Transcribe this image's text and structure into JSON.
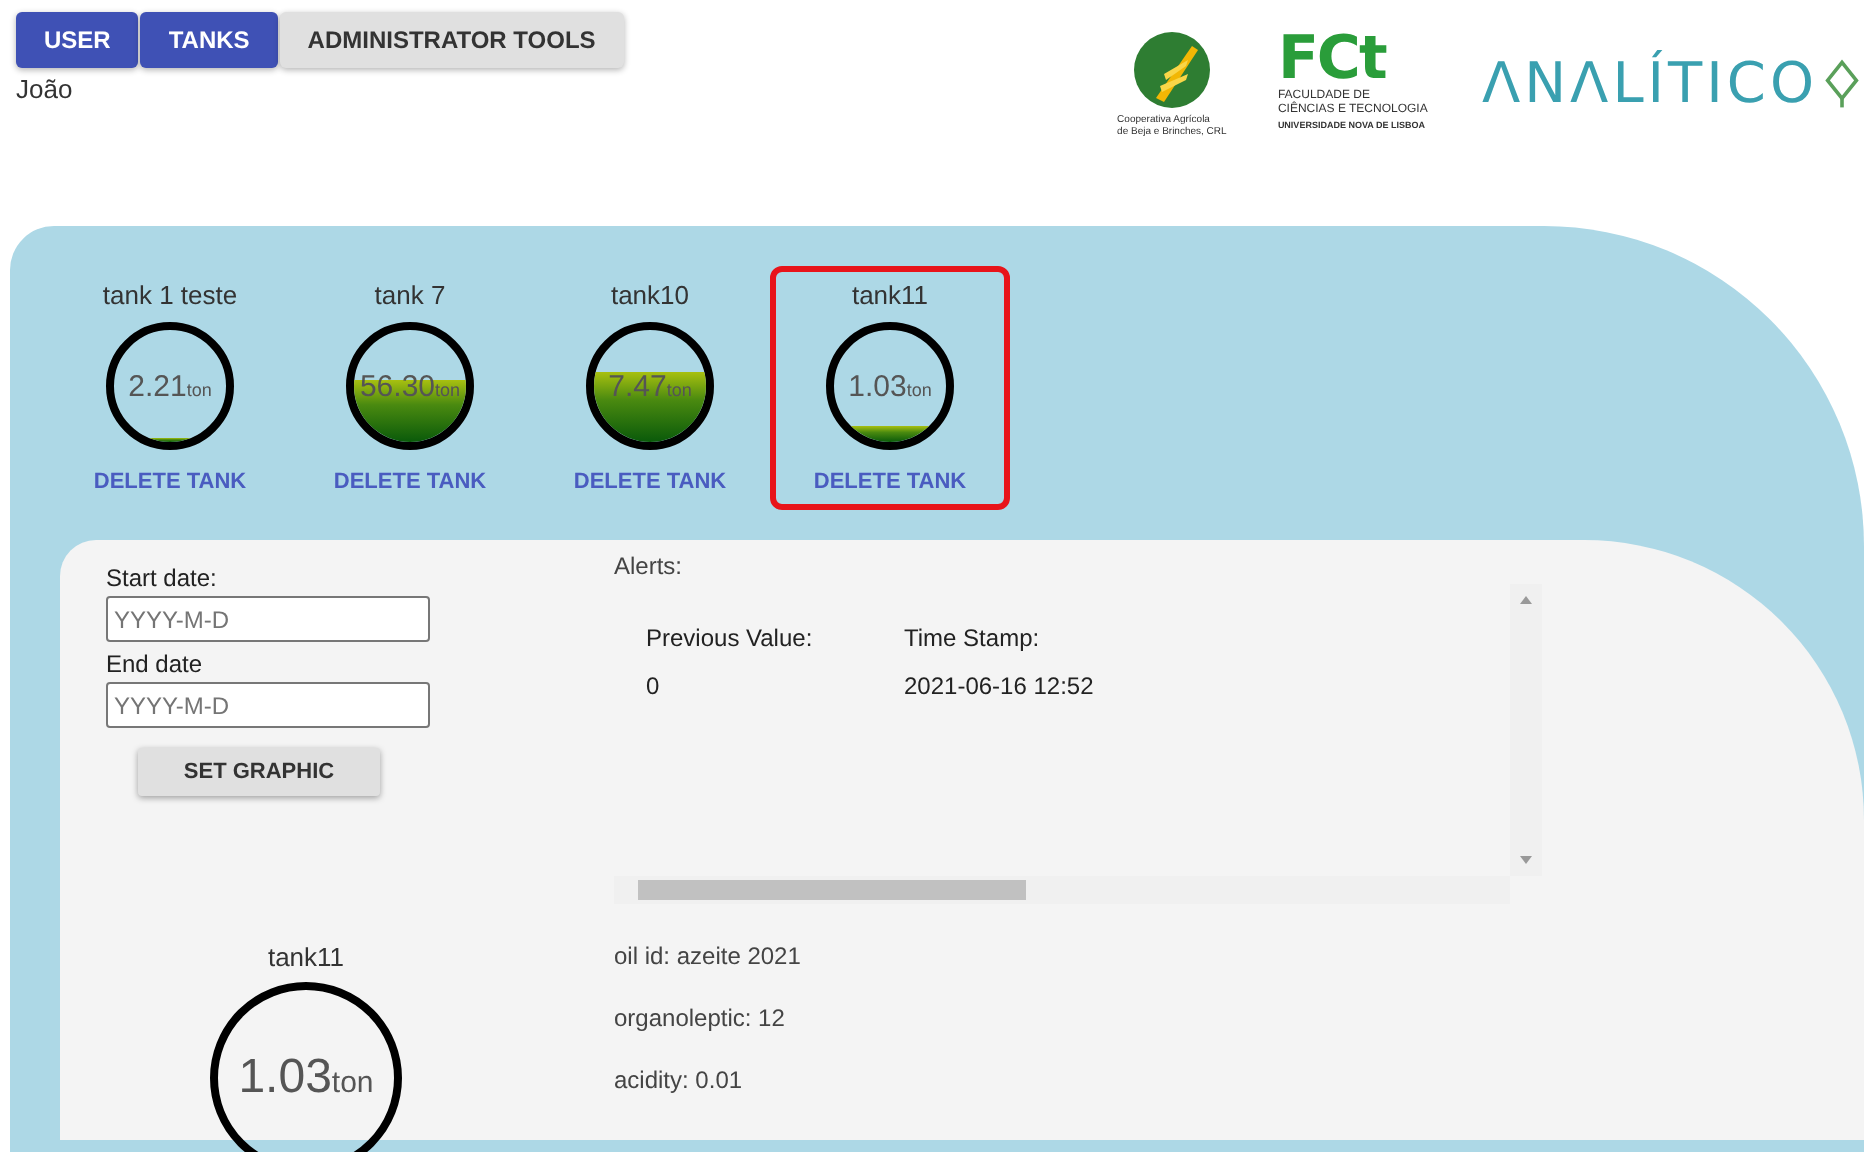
{
  "nav": {
    "tabs": [
      {
        "label": "USER",
        "selected": true
      },
      {
        "label": "TANKS",
        "selected": true
      },
      {
        "label": "ADMINISTRATOR TOOLS",
        "selected": false
      }
    ],
    "user": "João"
  },
  "logos": {
    "coop": [
      "Cooperativa Agrícola",
      "de Beja e Brinches, CRL"
    ],
    "fct": {
      "mark": "FCt",
      "lines": [
        "FACULDADE DE",
        "CIÊNCIAS E TECNOLOGIA",
        "UNIVERSIDADE NOVA DE LISBOA"
      ]
    },
    "brand": "ΛNΛLÍTICO"
  },
  "tanks": [
    {
      "name": "tank 1 teste",
      "amount": "2.21",
      "unit": "ton",
      "selected": false,
      "action": "DELETE TANK"
    },
    {
      "name": "tank 7",
      "amount": "56.30",
      "unit": "ton",
      "selected": false,
      "action": "DELETE TANK"
    },
    {
      "name": "tank10",
      "amount": "7.47",
      "unit": "ton",
      "selected": false,
      "action": "DELETE TANK"
    },
    {
      "name": "tank11",
      "amount": "1.03",
      "unit": "ton",
      "selected": true,
      "action": "DELETE TANK"
    }
  ],
  "filters": {
    "start_label": "Start date:",
    "start_placeholder": "YYYY-M-D",
    "end_label": "End date",
    "end_placeholder": "YYYY-M-D",
    "button": "SET GRAPHIC"
  },
  "alerts": {
    "title": "Alerts:",
    "columns": [
      "Previous Value:",
      "Time Stamp:"
    ],
    "rows": [
      [
        "0",
        "2021-06-16 12:52"
      ]
    ]
  },
  "detail": {
    "name": "tank11",
    "amount": "1.03",
    "unit": "ton",
    "info": [
      "oil id: azeite 2021",
      "organoleptic: 12",
      "acidity: 0.01"
    ]
  }
}
